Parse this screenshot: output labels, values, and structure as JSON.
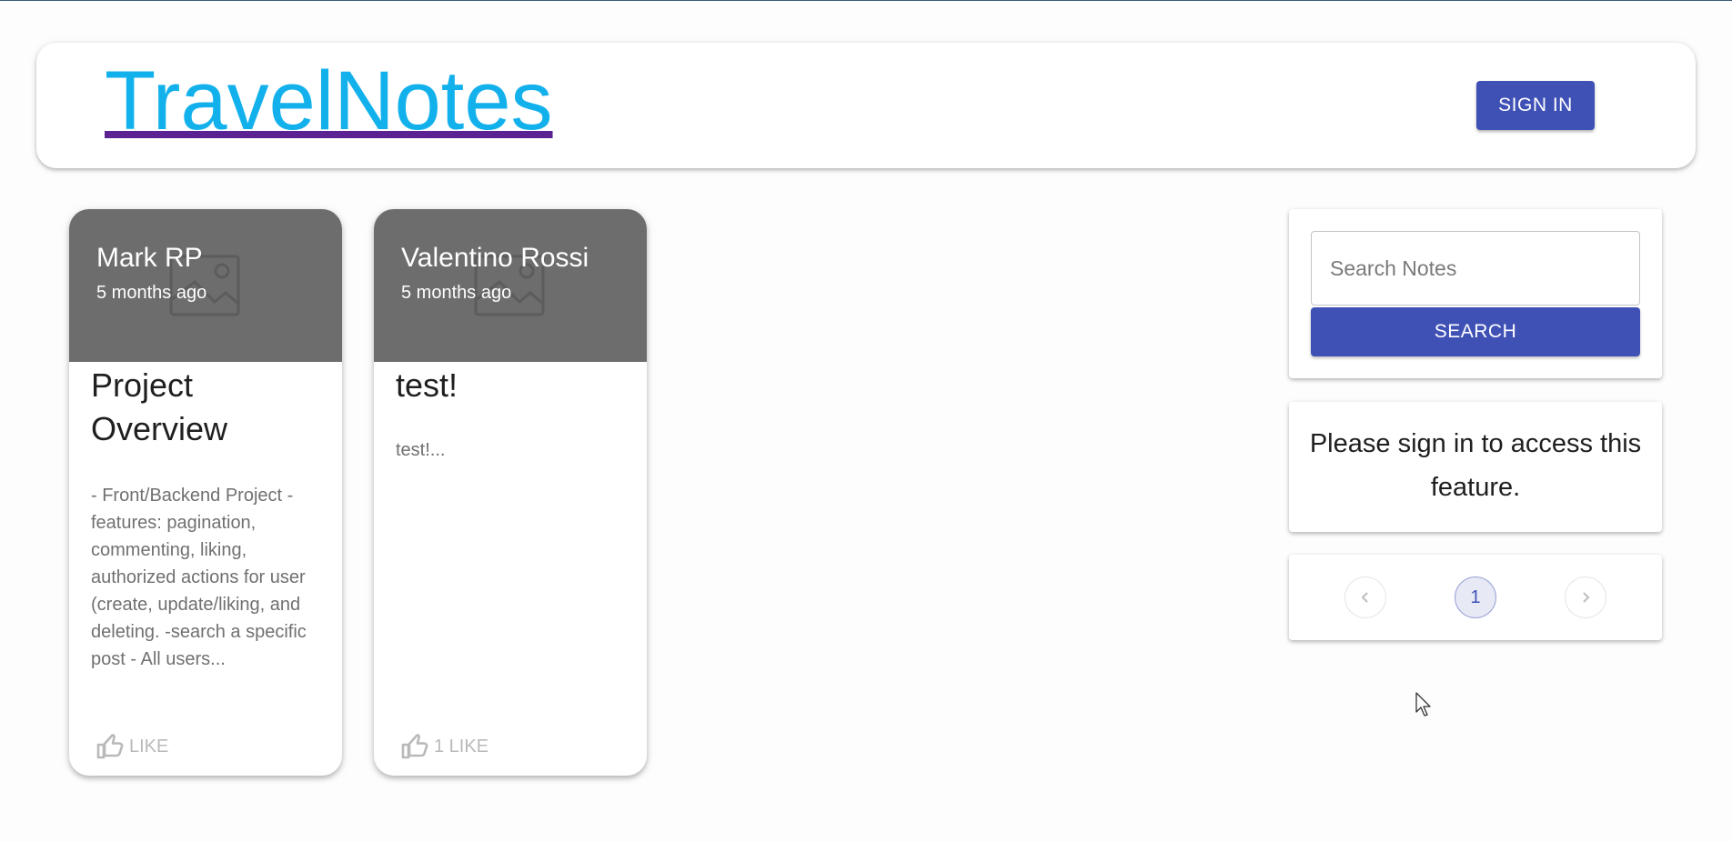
{
  "header": {
    "brand": "TravelNotes",
    "signin_label": "SIGN IN"
  },
  "posts": [
    {
      "author": "Mark RP",
      "time": "5 months ago",
      "title": "Project Overview",
      "excerpt": "- Front/Backend Project - features: pagination, commenting, liking, authorized actions for user (create, update/liking, and deleting. -search a specific post - All users...",
      "like_label": "LIKE"
    },
    {
      "author": "Valentino Rossi",
      "time": "5 months ago",
      "title": "test!",
      "excerpt": "test!...",
      "like_label": "1 LIKE"
    }
  ],
  "search": {
    "placeholder": "Search Notes",
    "value": "",
    "button_label": "SEARCH"
  },
  "notice": {
    "text": "Please sign in to access this feature."
  },
  "pagination": {
    "current": "1",
    "prev_icon": "chevron-left-icon",
    "next_icon": "chevron-right-icon"
  },
  "colors": {
    "brand": "#13b1ec",
    "brand_underline": "#5a2293",
    "primary": "#3f51b5",
    "media_bg": "#6d6d6d"
  }
}
